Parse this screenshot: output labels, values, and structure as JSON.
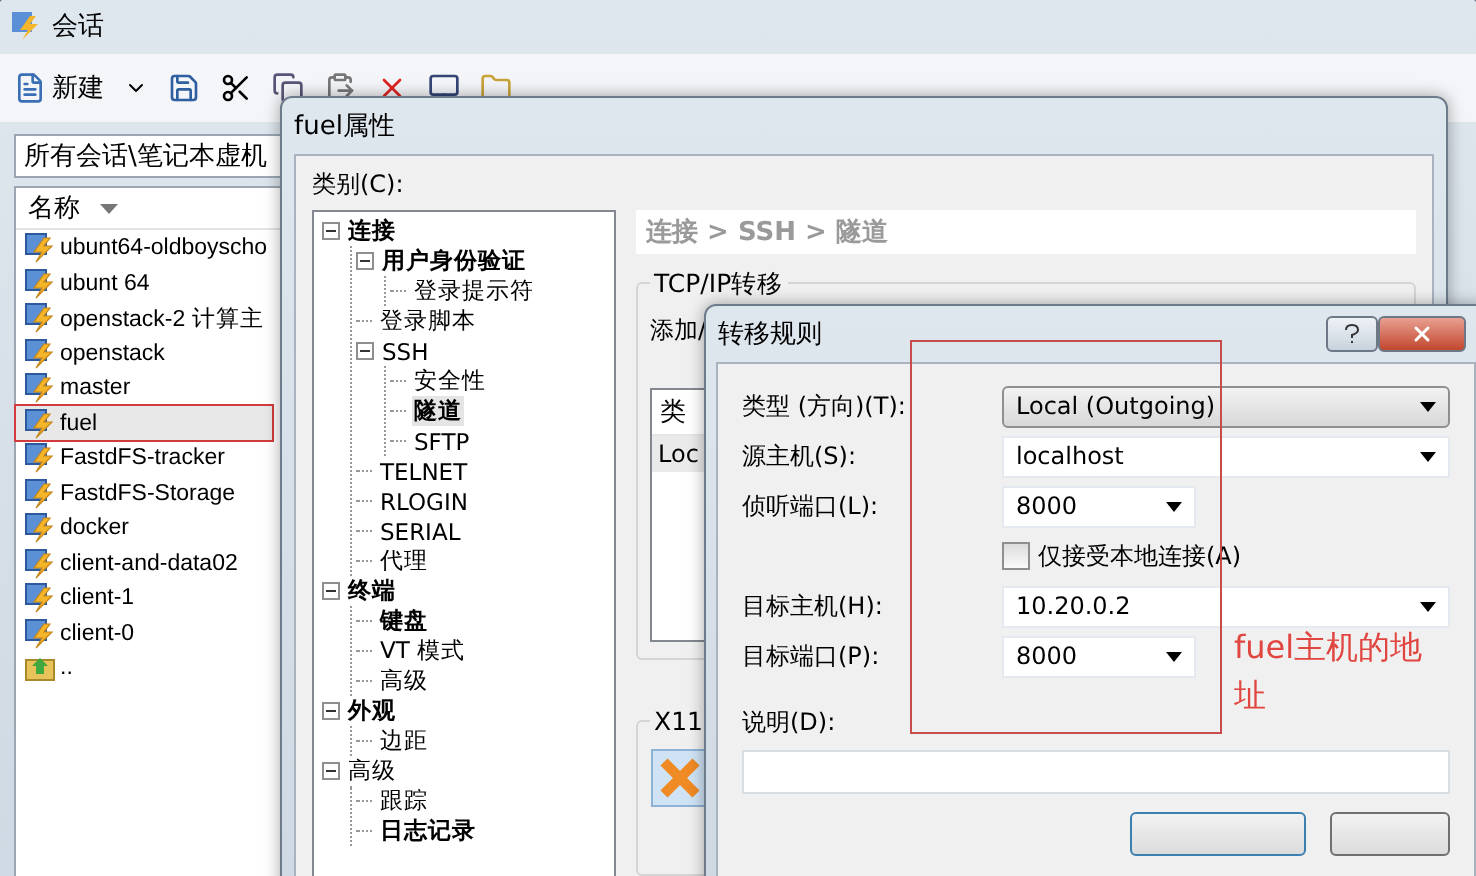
{
  "session_window": {
    "title": "会话",
    "new_label": "新建",
    "path": "所有会话\\笔记本虚机",
    "column_header": "名称",
    "sessions": [
      {
        "name": "ubunt64-oldboyscho",
        "kind": "session",
        "selected": false,
        "marked": false
      },
      {
        "name": "ubunt 64",
        "kind": "session",
        "selected": false,
        "marked": false
      },
      {
        "name": "openstack-2 计算主",
        "kind": "session",
        "selected": false,
        "marked": false
      },
      {
        "name": "openstack",
        "kind": "session",
        "selected": false,
        "marked": false
      },
      {
        "name": "master",
        "kind": "session",
        "selected": false,
        "marked": false
      },
      {
        "name": "fuel",
        "kind": "session",
        "selected": true,
        "marked": true
      },
      {
        "name": "FastdFS-tracker",
        "kind": "session",
        "selected": false,
        "marked": false
      },
      {
        "name": "FastdFS-Storage",
        "kind": "session",
        "selected": false,
        "marked": false
      },
      {
        "name": "docker",
        "kind": "session",
        "selected": false,
        "marked": false
      },
      {
        "name": "client-and-data02",
        "kind": "session",
        "selected": false,
        "marked": false
      },
      {
        "name": "client-1",
        "kind": "session",
        "selected": false,
        "marked": false
      },
      {
        "name": "client-0",
        "kind": "session",
        "selected": false,
        "marked": false
      },
      {
        "name": "..",
        "kind": "parent-folder",
        "selected": false,
        "marked": false
      }
    ]
  },
  "properties_window": {
    "title": "fuel属性",
    "category_label": "类别(C):",
    "tree": [
      {
        "label": "连接",
        "bold": true,
        "selected": false,
        "expanded": true,
        "children": [
          {
            "label": "用户身份验证",
            "bold": true,
            "selected": false,
            "expanded": true,
            "children": [
              {
                "label": "登录提示符",
                "bold": false,
                "selected": false
              }
            ]
          },
          {
            "label": "登录脚本",
            "bold": false,
            "selected": false
          },
          {
            "label": "SSH",
            "bold": false,
            "selected": false,
            "expanded": true,
            "children": [
              {
                "label": "安全性",
                "bold": false,
                "selected": false
              },
              {
                "label": "隧道",
                "bold": true,
                "selected": true
              },
              {
                "label": "SFTP",
                "bold": false,
                "selected": false
              }
            ]
          },
          {
            "label": "TELNET",
            "bold": false,
            "selected": false
          },
          {
            "label": "RLOGIN",
            "bold": false,
            "selected": false
          },
          {
            "label": "SERIAL",
            "bold": false,
            "selected": false
          },
          {
            "label": "代理",
            "bold": false,
            "selected": false
          }
        ]
      },
      {
        "label": "终端",
        "bold": true,
        "selected": false,
        "expanded": true,
        "children": [
          {
            "label": "键盘",
            "bold": true,
            "selected": false
          },
          {
            "label": "VT 模式",
            "bold": false,
            "selected": false
          },
          {
            "label": "高级",
            "bold": false,
            "selected": false
          }
        ]
      },
      {
        "label": "外观",
        "bold": true,
        "selected": false,
        "expanded": true,
        "children": [
          {
            "label": "边距",
            "bold": false,
            "selected": false
          }
        ]
      },
      {
        "label": "高级",
        "bold": false,
        "selected": false,
        "expanded": true,
        "children": [
          {
            "label": "跟踪",
            "bold": false,
            "selected": false
          },
          {
            "label": "日志记录",
            "bold": true,
            "selected": false
          }
        ]
      }
    ],
    "breadcrumb": "连接 > SSH > 隧道",
    "tcp_group": {
      "title": "TCP/IP转移",
      "description": "添加/",
      "table_header": "类",
      "table_row": "Loc"
    },
    "x11_group": {
      "title": "X11"
    }
  },
  "rule_dialog": {
    "title": "转移规则",
    "fields": [
      {
        "kind": "dropdown",
        "label": "类型 (方向)(T):",
        "value": "Local (Outgoing)"
      },
      {
        "kind": "combo",
        "label": "源主机(S):",
        "value": "localhost"
      },
      {
        "kind": "port",
        "label": "侦听端口(L):",
        "value": "8000"
      },
      {
        "kind": "checkbox",
        "label": "仅接受本地连接(A)",
        "checked": false
      },
      {
        "kind": "combo",
        "label": "目标主机(H):",
        "value": "10.20.0.2"
      },
      {
        "kind": "port",
        "label": "目标端口(P):",
        "value": "8000"
      },
      {
        "kind": "text",
        "label": "说明(D):"
      }
    ],
    "annotation": "fuel主机的地址"
  }
}
